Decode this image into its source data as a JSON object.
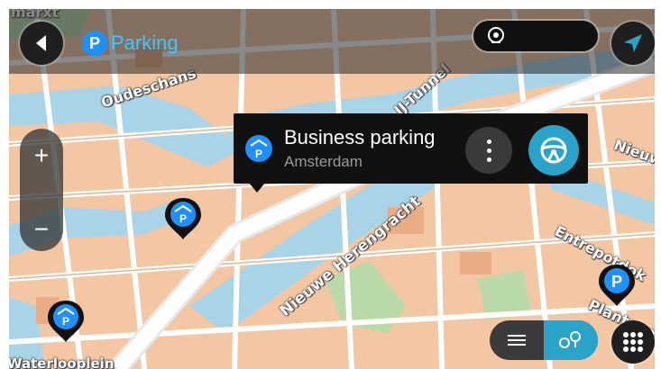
{
  "topbar": {
    "category_label": "Parking",
    "category_badge": "P",
    "back_icon": "back-arrow-icon",
    "search_icon": "location-pin-icon",
    "nav_icon": "navigation-arrow-icon"
  },
  "popup": {
    "title": "Business parking",
    "subtitle": "Amsterdam",
    "icon": "parking-garage-icon",
    "more_icon": "more-vertical-icon",
    "drive_icon": "steering-wheel-icon"
  },
  "zoom": {
    "in_label": "+",
    "out_label": "−"
  },
  "map_labels": {
    "top_left": "marxt",
    "oudeschans": "Oudeschans",
    "tunnel": "IJ-Tunnel",
    "herengracht": "Nieuwe Herengracht",
    "entrepotdok": "Entrepotdok",
    "nieuw": "Nieuw",
    "plantage": "Plantage",
    "waterlooplein": "Waterlooplein"
  },
  "pins": [
    {
      "type": "parking-garage",
      "badge": "P"
    },
    {
      "type": "parking-garage",
      "badge": "P"
    },
    {
      "type": "parking",
      "badge": "P"
    }
  ],
  "bottom": {
    "list_icon": "list-view-icon",
    "map_icon": "map-view-icon",
    "menu_icon": "main-menu-grid-icon"
  },
  "colors": {
    "accent": "#2aa3c9",
    "parking_blue": "#1e90ff",
    "category_text": "#3ec7ff",
    "map_blocks": "#f3c7a4",
    "roads": "#ffffff",
    "water": "#a9d3e6"
  }
}
